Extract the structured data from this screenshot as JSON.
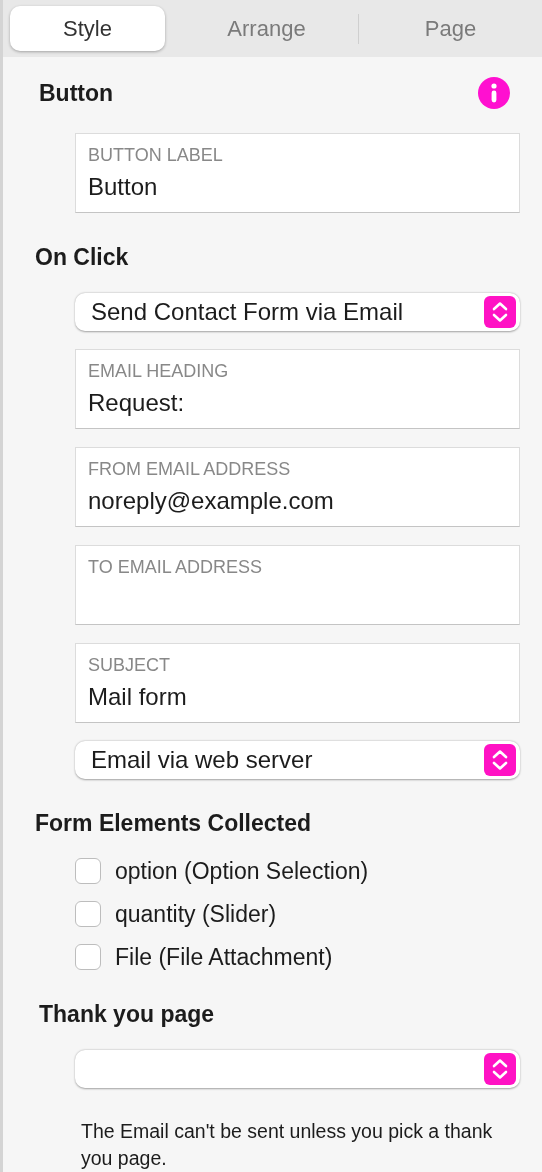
{
  "tabs": [
    {
      "label": "Style",
      "selected": true
    },
    {
      "label": "Arrange",
      "selected": false
    },
    {
      "label": "Page",
      "selected": false
    }
  ],
  "sections": [
    {
      "heading": "Button",
      "info": true,
      "items": [
        {
          "kind": "field",
          "label": "BUTTON LABEL",
          "value": "Button"
        }
      ]
    },
    {
      "heading": "On Click",
      "items": [
        {
          "kind": "select",
          "value": "Send Contact Form via Email"
        },
        {
          "kind": "field",
          "label": "EMAIL HEADING",
          "value": "Request:"
        },
        {
          "kind": "field",
          "label": "FROM EMAIL ADDRESS",
          "value": "noreply@example.com"
        },
        {
          "kind": "field",
          "label": "TO EMAIL ADDRESS"
        },
        {
          "kind": "field",
          "label": "SUBJECT",
          "value": "Mail form"
        },
        {
          "kind": "select",
          "value": "Email via web server"
        }
      ]
    },
    {
      "heading": "Form Elements Collected",
      "items": [
        {
          "kind": "checkbox",
          "label": "option (Option Selection)",
          "checked": false
        },
        {
          "kind": "checkbox",
          "label": "quantity (Slider)",
          "checked": false
        },
        {
          "kind": "checkbox",
          "label": "File (File Attachment)",
          "checked": false
        }
      ]
    },
    {
      "heading": "Thank you page",
      "items": [
        {
          "kind": "select"
        },
        {
          "kind": "note",
          "text": "The Email can't be sent unless you pick a thank you page."
        }
      ]
    }
  ]
}
